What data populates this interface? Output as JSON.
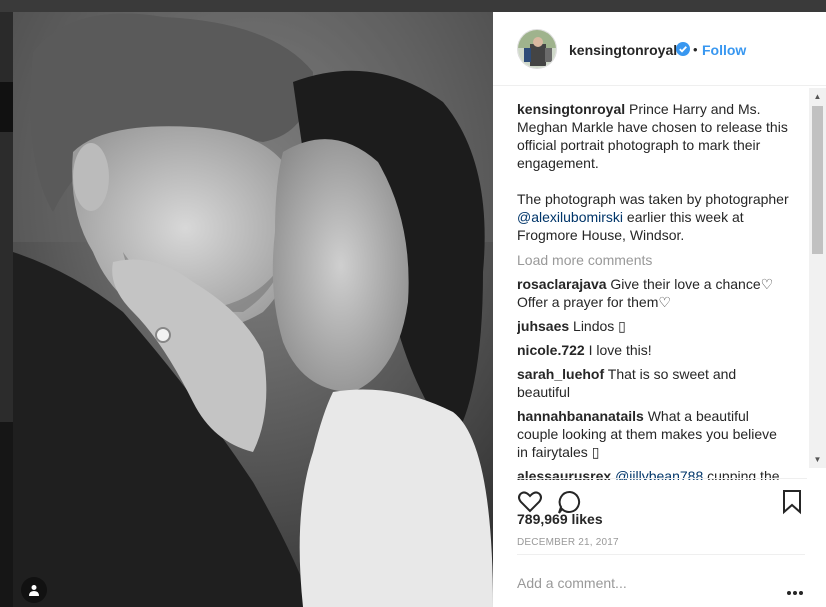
{
  "post": {
    "username": "kensingtonroyal",
    "dot": "•",
    "follow_label": "Follow",
    "caption_line1": "Prince Harry and Ms. Meghan Markle have chosen to release this official portrait photograph to mark their engagement.",
    "caption_p2_before": "The photograph was taken by photographer ",
    "caption_mention": "@alexilubomirski",
    "caption_p2_after": " earlier this week at Frogmore House, Windsor.",
    "load_more": "Load more comments",
    "comments": [
      {
        "user": "rosaclarajava",
        "text": "Give their love a chance♡ Offer a prayer for them♡"
      },
      {
        "user": "juhsaes",
        "text": "Lindos ▯"
      },
      {
        "user": "nicole.722",
        "text": "I love this!"
      },
      {
        "user": "sarah_luehof",
        "text": "That is so sweet and beautiful"
      },
      {
        "user": "hannahbananatails",
        "text": "What a beautiful couple looking at them makes you believe in fairytales ▯"
      },
      {
        "user": "alessaurusrex",
        "mention": "@jillybean788",
        "text": "cupping the"
      }
    ],
    "likes": "789,969 likes",
    "date": "DECEMBER 21, 2017",
    "add_comment_placeholder": "Add a comment...",
    "more_label": "•••"
  },
  "icons": {
    "verified": "verified-badge-icon",
    "like": "heart-icon",
    "comment": "speech-bubble-icon",
    "save": "bookmark-icon",
    "tag": "person-tag-icon"
  },
  "colors": {
    "link": "#3897f0",
    "mention": "#003569",
    "muted": "#999999"
  }
}
